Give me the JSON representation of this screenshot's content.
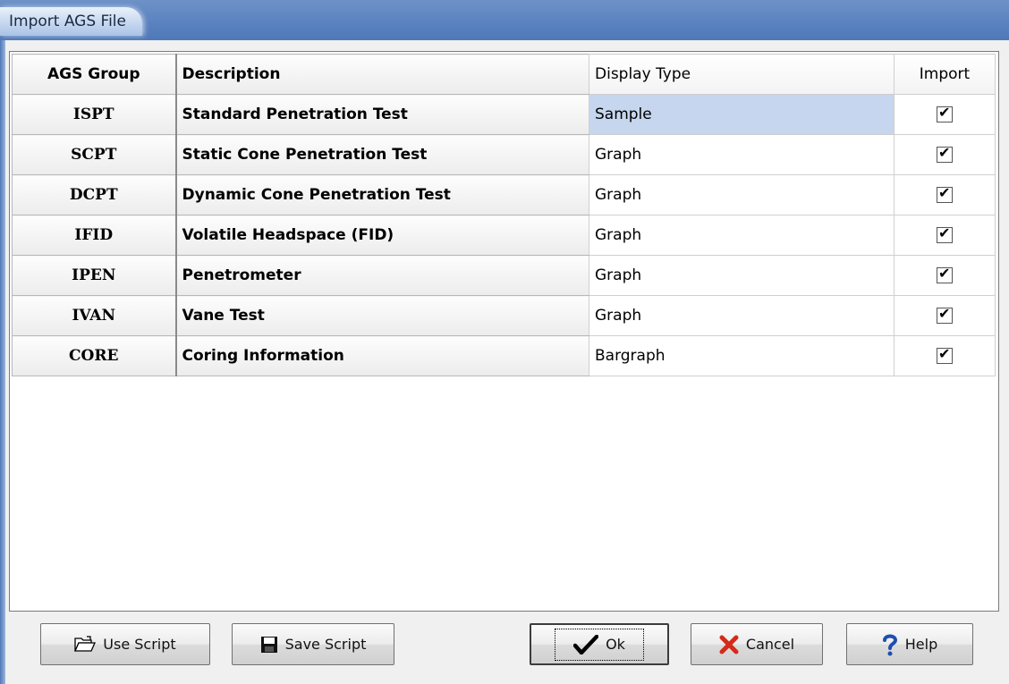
{
  "window": {
    "title": "Import AGS File"
  },
  "table": {
    "headers": [
      "AGS Group",
      "Description",
      "Display Type",
      "Import"
    ],
    "rows": [
      {
        "group": "ISPT",
        "description": "Standard Penetration Test",
        "display_type": "Sample",
        "import": true
      },
      {
        "group": "SCPT",
        "description": "Static Cone Penetration Test",
        "display_type": "Graph",
        "import": true
      },
      {
        "group": "DCPT",
        "description": "Dynamic Cone Penetration Test",
        "display_type": "Graph",
        "import": true
      },
      {
        "group": "IFID",
        "description": "Volatile Headspace (FID)",
        "display_type": "Graph",
        "import": true
      },
      {
        "group": "IPEN",
        "description": "Penetrometer",
        "display_type": "Graph",
        "import": true
      },
      {
        "group": "IVAN",
        "description": "Vane Test",
        "display_type": "Graph",
        "import": true
      },
      {
        "group": "CORE",
        "description": "Coring Information",
        "display_type": "Bargraph",
        "import": true
      }
    ]
  },
  "buttons": {
    "use_script": "Use Script",
    "save_script": "Save Script",
    "ok": "Ok",
    "cancel": "Cancel",
    "help": "Help"
  },
  "icons": {
    "use_script": "folder-open-icon",
    "save_script": "floppy-disk-icon",
    "ok": "checkmark-icon",
    "cancel": "red-x-icon",
    "help": "question-mark-icon"
  },
  "colors": {
    "selection": "#c5d6ee",
    "title_bar": "#5b83c0",
    "cancel_icon": "#d42a1a",
    "help_icon": "#1d4fb0"
  }
}
